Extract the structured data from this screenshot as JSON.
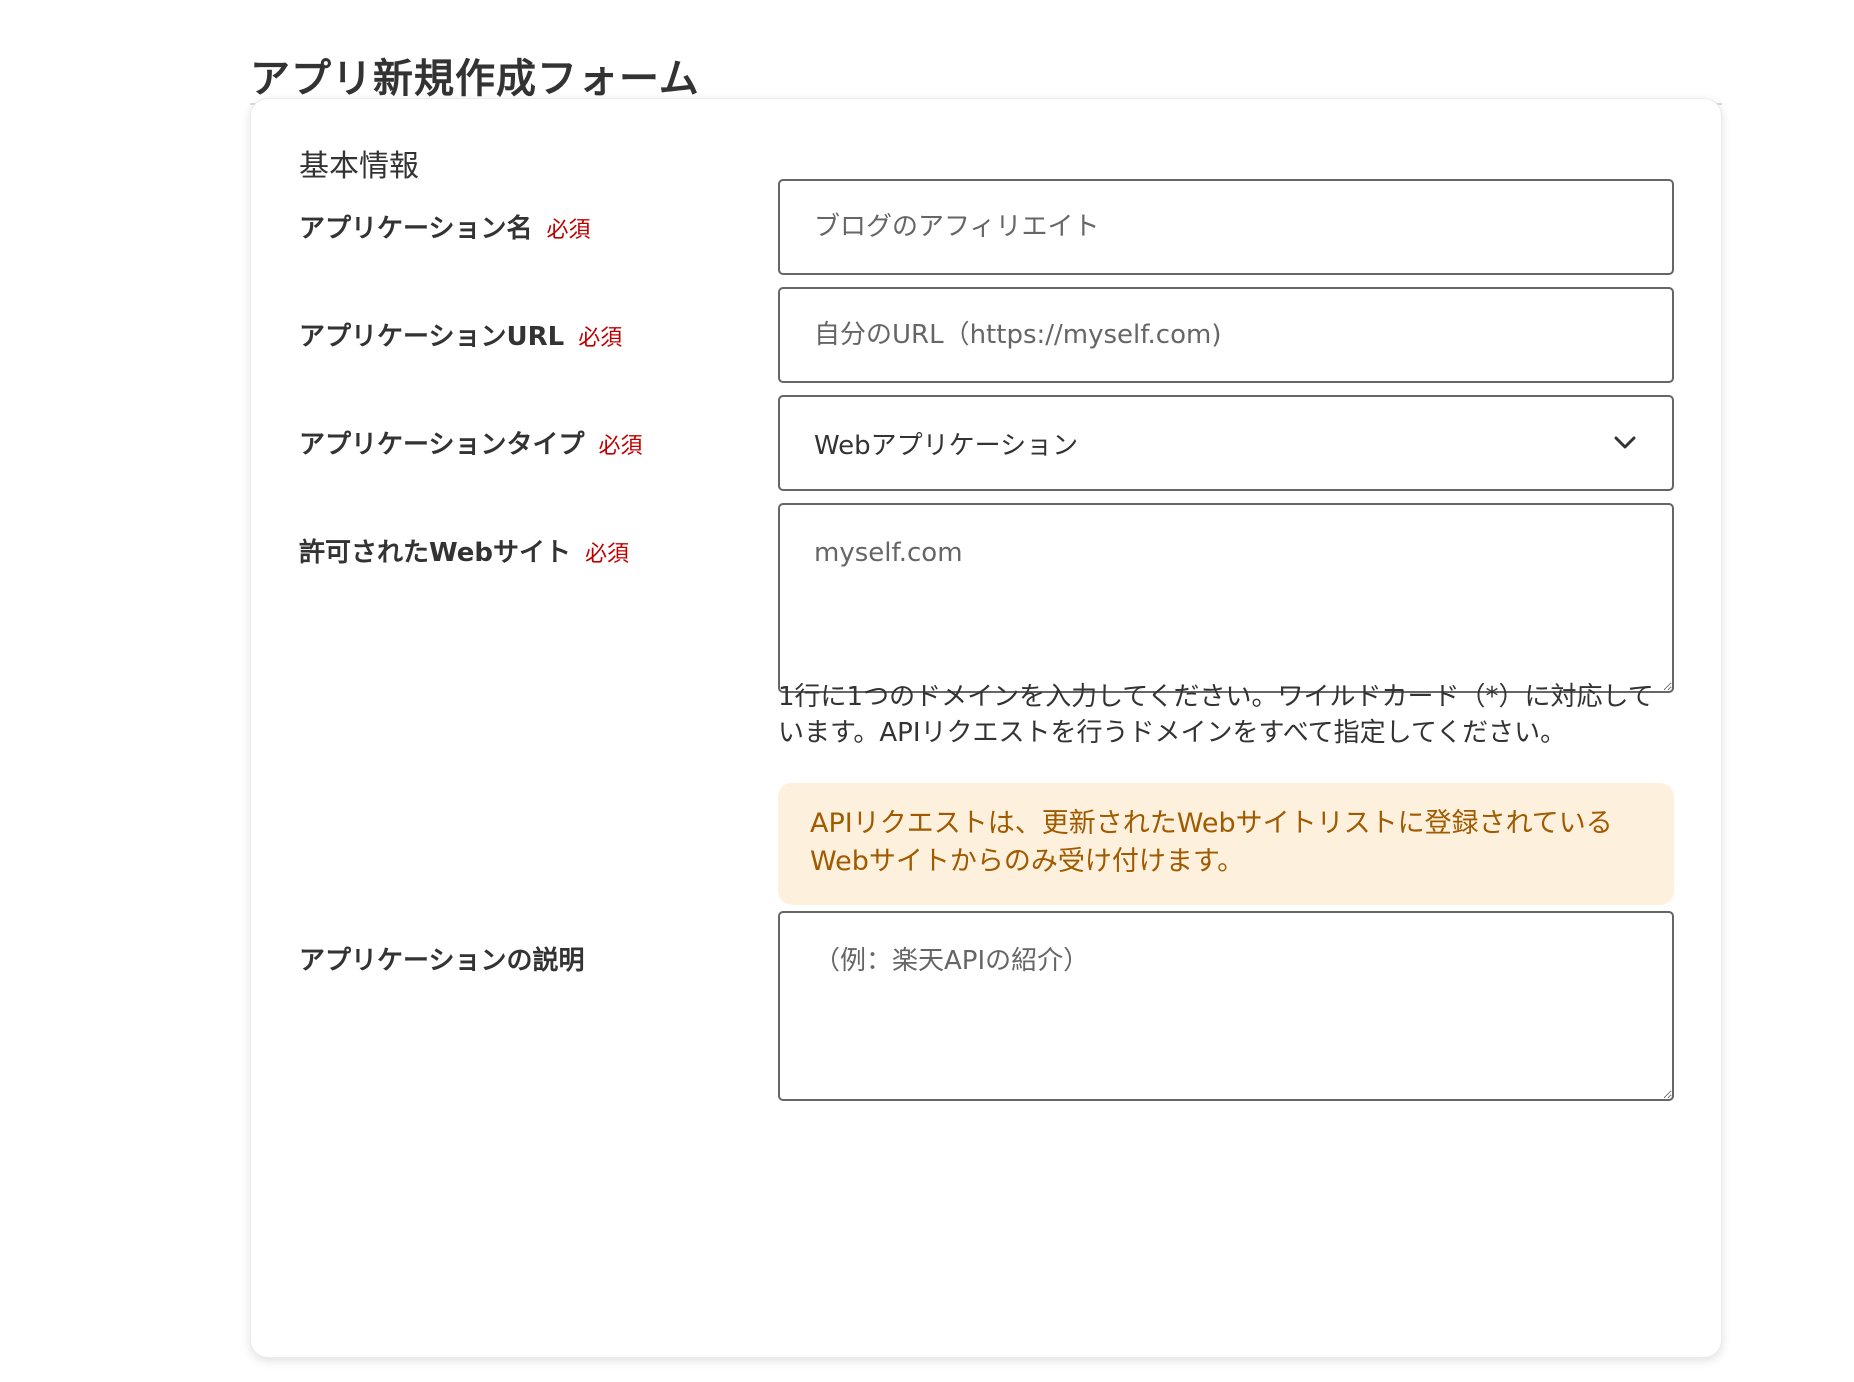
{
  "page": {
    "title": "アプリ新規作成フォーム"
  },
  "form": {
    "section_heading": "基本情報",
    "required_label": "必須",
    "fields": {
      "app_name": {
        "label": "アプリケーション名",
        "placeholder": "ブログのアフィリエイト"
      },
      "app_url": {
        "label": "アプリケーションURL",
        "placeholder": "自分のURL（https://myself.com)"
      },
      "app_type": {
        "label": "アプリケーションタイプ",
        "selected": "Webアプリケーション"
      },
      "allowed_sites": {
        "label": "許可されたWebサイト",
        "placeholder": "myself.com",
        "help": "1行に1つのドメインを入力してください。ワイルドカード（*）に対応しています。APIリクエストを行うドメインをすべて指定してください。",
        "notice": "APIリクエストは、更新されたWebサイトリストに登録されているWebサイトからのみ受け付けます。"
      },
      "description": {
        "label": "アプリケーションの説明",
        "placeholder": "（例：楽天APIの紹介）"
      }
    }
  },
  "colors": {
    "required": "#c00000",
    "notice_bg": "#fdf1dd",
    "notice_text": "#a05a00"
  },
  "icons": {
    "select_indicator": "chevron-down-icon"
  }
}
